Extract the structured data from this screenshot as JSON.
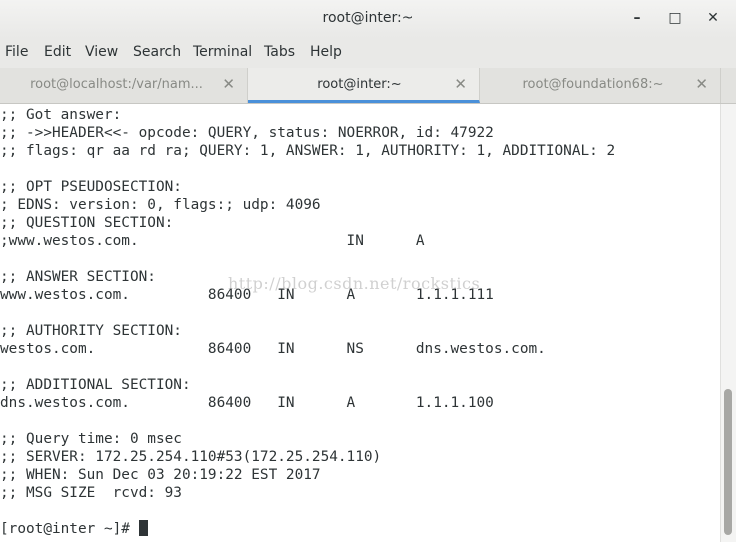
{
  "window": {
    "title": "root@inter:~",
    "minimize_icon": "minimize-icon",
    "maximize_icon": "maximize-icon",
    "close_icon": "close-icon"
  },
  "menu": [
    "File",
    "Edit",
    "View",
    "Search",
    "Terminal",
    "Tabs",
    "Help"
  ],
  "tabs": [
    {
      "label": "root@localhost:/var/nam...",
      "active": false
    },
    {
      "label": "root@inter:~",
      "active": true
    },
    {
      "label": "root@foundation68:~",
      "active": false
    }
  ],
  "terminal": {
    "lines": [
      ";; Got answer:",
      ";; ->>HEADER<<- opcode: QUERY, status: NOERROR, id: 47922",
      ";; flags: qr aa rd ra; QUERY: 1, ANSWER: 1, AUTHORITY: 1, ADDITIONAL: 2",
      "",
      ";; OPT PSEUDOSECTION:",
      "; EDNS: version: 0, flags:; udp: 4096",
      ";; QUESTION SECTION:",
      ";www.westos.com.                        IN      A",
      "",
      ";; ANSWER SECTION:",
      "www.westos.com.         86400   IN      A       1.1.1.111",
      "",
      ";; AUTHORITY SECTION:",
      "westos.com.             86400   IN      NS      dns.westos.com.",
      "",
      ";; ADDITIONAL SECTION:",
      "dns.westos.com.         86400   IN      A       1.1.1.100",
      "",
      ";; Query time: 0 msec",
      ";; SERVER: 172.25.254.110#53(172.25.254.110)",
      ";; WHEN: Sun Dec 03 20:19:22 EST 2017",
      ";; MSG SIZE  rcvd: 93",
      ""
    ],
    "prompt": "[root@inter ~]# ",
    "watermark": "http://blog.csdn.net/rockstics"
  },
  "colors": {
    "accent": "#4a90d9",
    "text": "#2e3436",
    "background": "#ffffff"
  }
}
